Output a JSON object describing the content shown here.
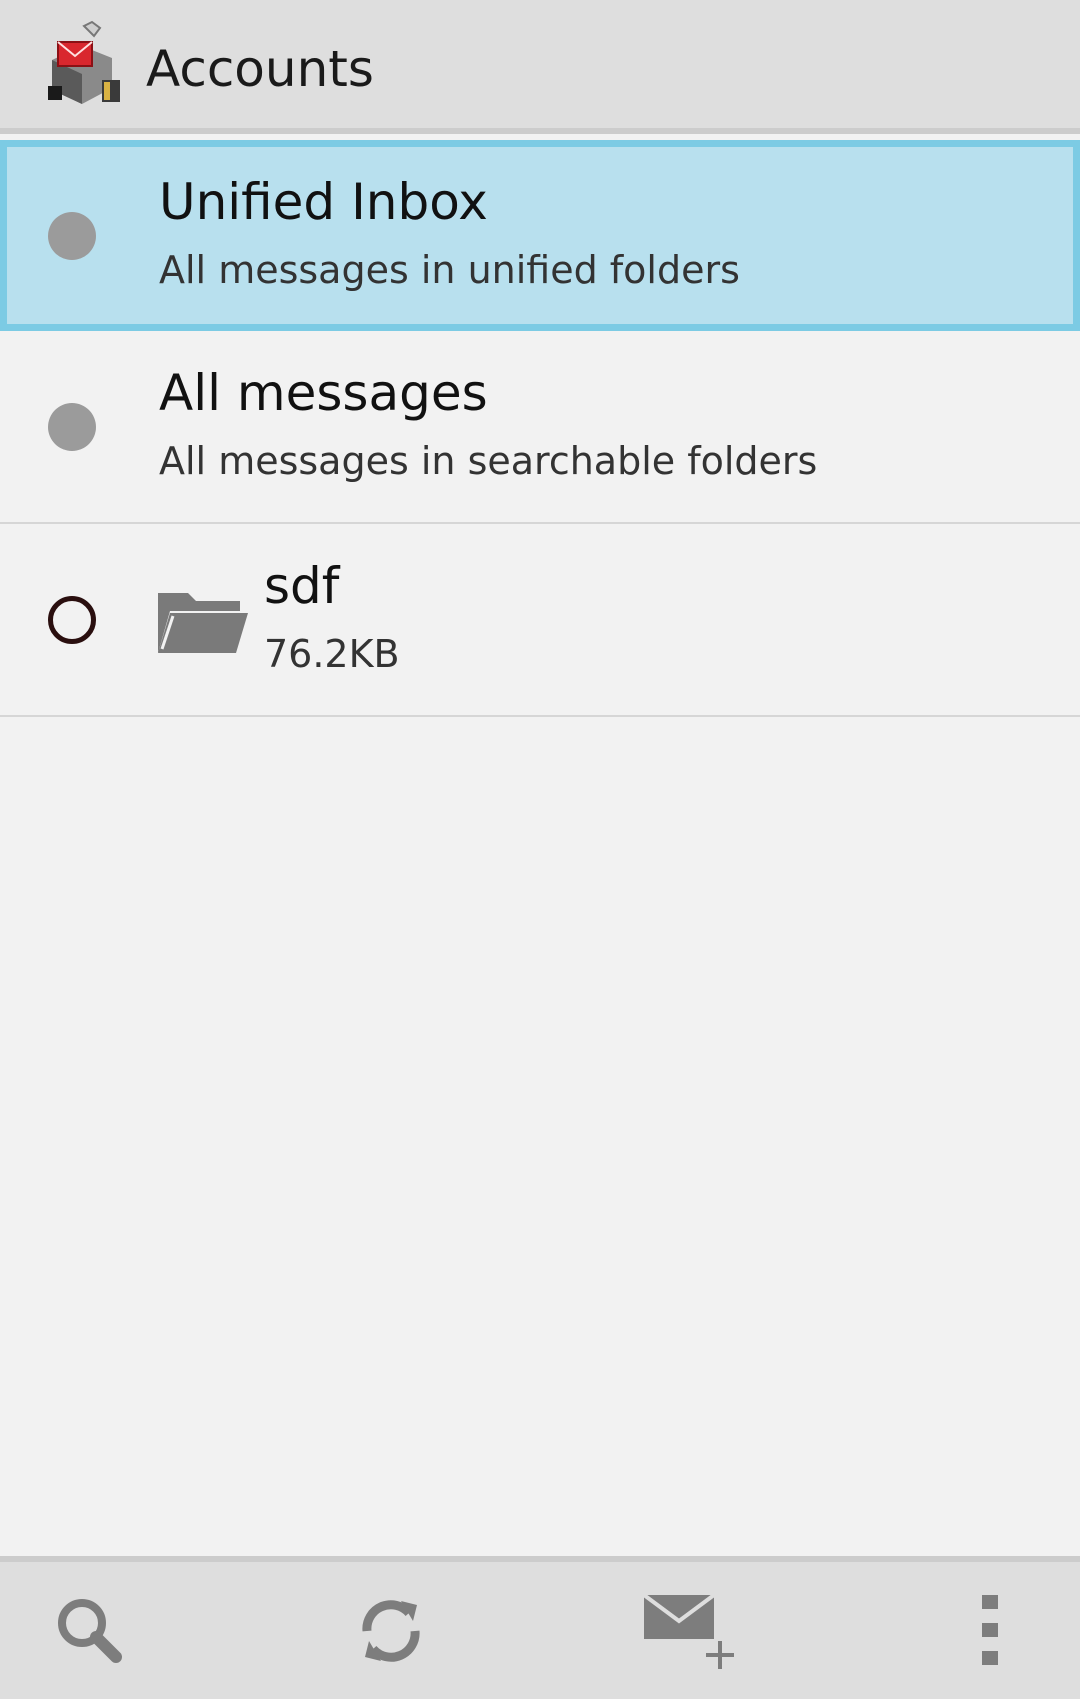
{
  "header": {
    "title": "Accounts",
    "icon": "app-logo-icon"
  },
  "rows": [
    {
      "title": "Unified Inbox",
      "subtitle": "All messages in unified folders",
      "indicator": "filled-dot",
      "selected": true
    },
    {
      "title": "All messages",
      "subtitle": "All messages in searchable folders",
      "indicator": "filled-dot",
      "selected": false
    },
    {
      "title": "sdf",
      "subtitle": "76.2KB",
      "indicator": "hollow-dot",
      "icon": "folder-icon",
      "selected": false
    }
  ],
  "bottom_bar": {
    "buttons": [
      "search-icon",
      "refresh-icon",
      "compose-icon",
      "overflow-menu-icon"
    ]
  },
  "colors": {
    "selected_bg": "#b8e0ee",
    "selected_border": "#7ccbe4",
    "bar_bg": "#dedede",
    "content_bg": "#f2f2f2"
  }
}
